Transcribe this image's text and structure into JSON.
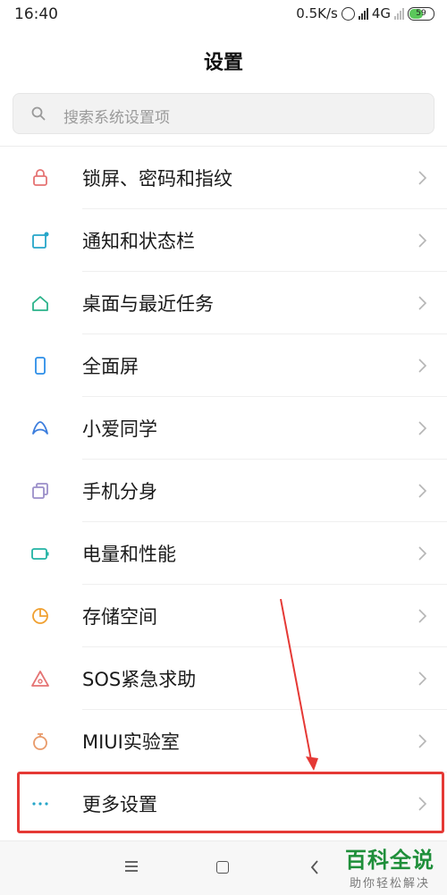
{
  "status_bar": {
    "time": "16:40",
    "net_speed": "0.5K/s",
    "network": "4G",
    "battery": "59"
  },
  "header": {
    "title": "设置"
  },
  "search": {
    "placeholder": "搜索系统设置项"
  },
  "settings": [
    {
      "label": "锁屏、密码和指纹",
      "icon": "lock-icon",
      "color": "#e57373"
    },
    {
      "label": "通知和状态栏",
      "icon": "notification-icon",
      "color": "#26a6c9"
    },
    {
      "label": "桌面与最近任务",
      "icon": "home-icon",
      "color": "#2bb38a"
    },
    {
      "label": "全面屏",
      "icon": "phone-icon",
      "color": "#2c8ee8"
    },
    {
      "label": "小爱同学",
      "icon": "xiaoai-icon",
      "color": "#3b7ddd"
    },
    {
      "label": "手机分身",
      "icon": "clone-icon",
      "color": "#9b8fc9"
    },
    {
      "label": "电量和性能",
      "icon": "battery-icon",
      "color": "#22b3a4"
    },
    {
      "label": "存储空间",
      "icon": "storage-icon",
      "color": "#f0a030"
    },
    {
      "label": "SOS紧急求助",
      "icon": "sos-icon",
      "color": "#e57373"
    },
    {
      "label": "MIUI实验室",
      "icon": "flask-icon",
      "color": "#e89a6a"
    },
    {
      "label": "更多设置",
      "icon": "more-icon",
      "color": "#26a6c9"
    }
  ],
  "watermark": {
    "main": "百科全说",
    "sub": "助你轻松解决"
  },
  "accent_color": "#e53935"
}
